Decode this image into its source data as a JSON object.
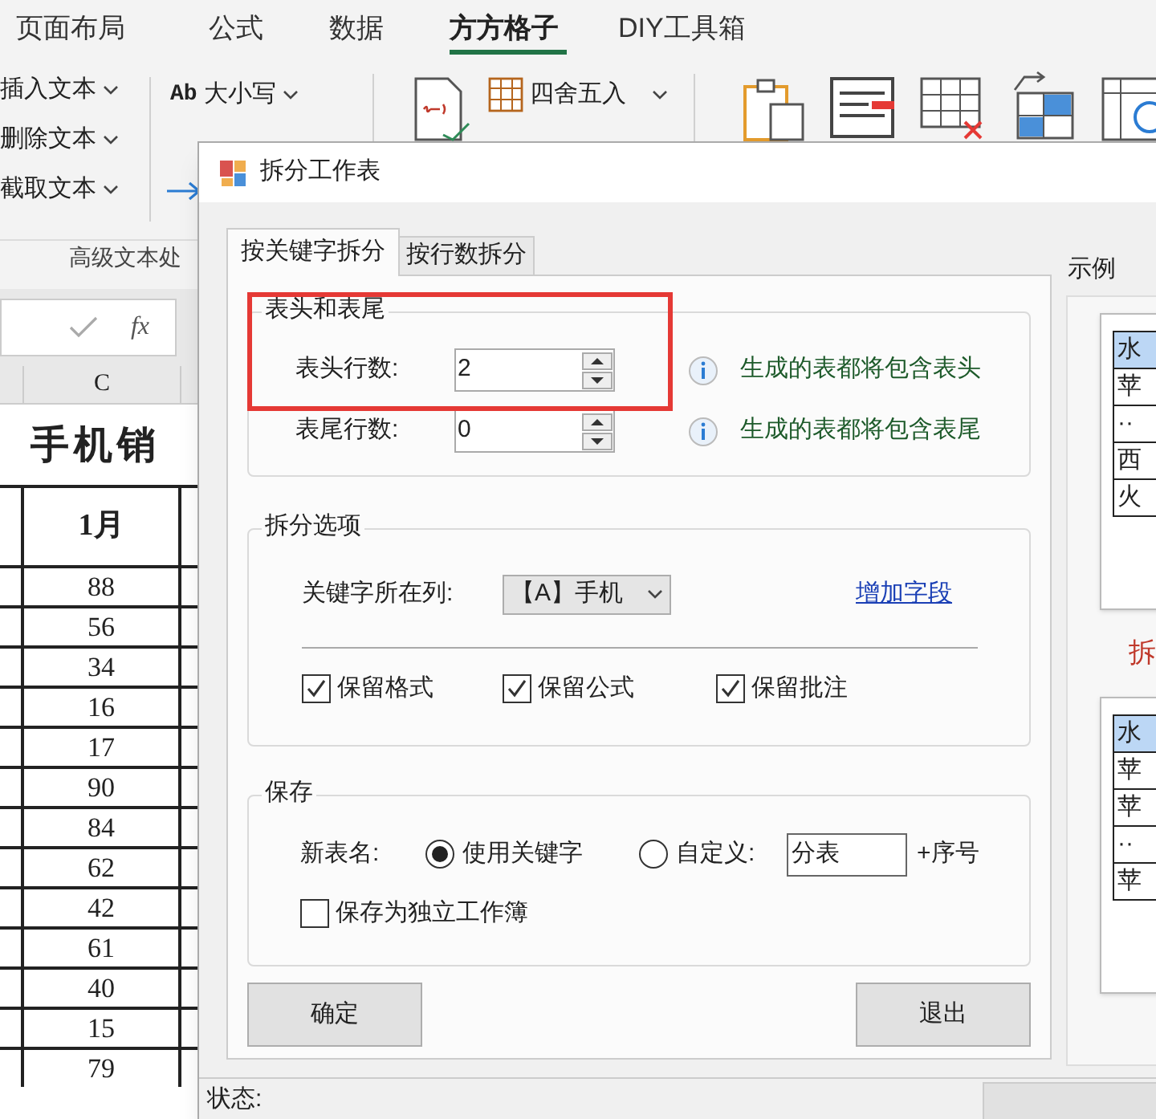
{
  "ribbon_tabs": [
    {
      "label": "页面布局",
      "selected": false
    },
    {
      "label": "公式",
      "selected": false
    },
    {
      "label": "数据",
      "selected": false
    },
    {
      "label": "方方格子",
      "selected": true
    },
    {
      "label": "DIY工具箱",
      "selected": false
    }
  ],
  "ribbon": {
    "text_commands": [
      "插入文本",
      "删除文本",
      "截取文本"
    ],
    "case_command": "大小写",
    "case_icon_text": "Ab",
    "round_command": "四舍五入",
    "group_label": "高级文本处"
  },
  "formula_bar": {
    "function_label": "fx"
  },
  "sheet": {
    "column_header": "C",
    "title": "手机销",
    "month_header": "1月",
    "values": [
      "88",
      "56",
      "34",
      "16",
      "17",
      "90",
      "84",
      "62",
      "42",
      "61",
      "40",
      "15",
      "79"
    ]
  },
  "dialog": {
    "title": "拆分工作表",
    "tabs": [
      {
        "label": "按关键字拆分",
        "selected": true
      },
      {
        "label": "按行数拆分",
        "selected": false
      }
    ],
    "header_footer": {
      "title": "表头和表尾",
      "fields": [
        {
          "label": "表头行数:",
          "value": "2",
          "hint": "生成的表都将包含表头"
        },
        {
          "label": "表尾行数:",
          "value": "0",
          "hint": "生成的表都将包含表尾"
        }
      ]
    },
    "split_options": {
      "title": "拆分选项",
      "key_column_label": "关键字所在列:",
      "key_column_value": "【A】手机",
      "add_field_link": "增加字段",
      "checkboxes": [
        {
          "label": "保留格式",
          "checked": true
        },
        {
          "label": "保留公式",
          "checked": true
        },
        {
          "label": "保留批注",
          "checked": true
        }
      ]
    },
    "save": {
      "title": "保存",
      "new_name_label": "新表名:",
      "radios": [
        {
          "label": "使用关键字",
          "selected": true
        },
        {
          "label": "自定义:",
          "selected": false
        }
      ],
      "custom_value": "分表",
      "suffix": "+序号",
      "standalone": {
        "label": "保存为独立工作簿",
        "checked": false
      }
    },
    "buttons": [
      "确定",
      "退出"
    ],
    "status_label": "状态:",
    "example": {
      "title": "示例",
      "tables": [
        {
          "cells": [
            "水",
            "苹",
            "··",
            "西",
            "火"
          ]
        },
        {
          "cells": [
            "水",
            "苹",
            "苹",
            "··",
            "苹"
          ]
        }
      ],
      "arrow_text": "拆"
    }
  }
}
